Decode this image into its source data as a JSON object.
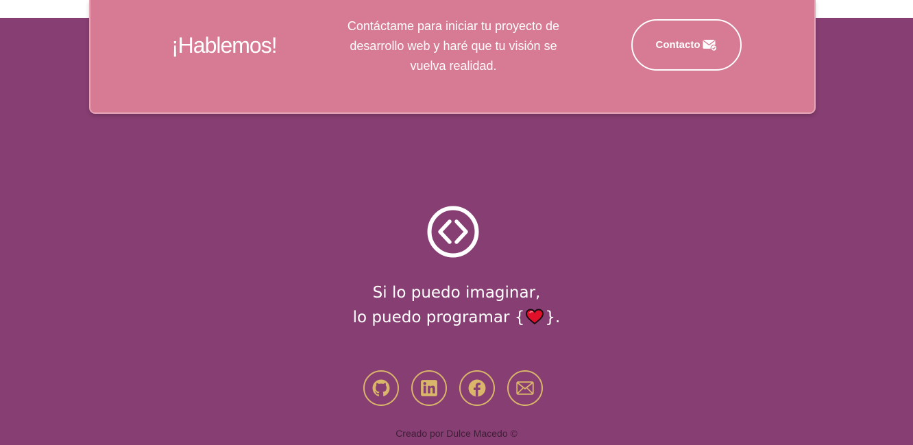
{
  "colors": {
    "background": "#873e72",
    "cta_card": "#d77a93",
    "accent_gold": "#d9b66a",
    "text_light": "#ffffff",
    "credit_text": "#3d1f37",
    "heart": "#e0102a"
  },
  "cta": {
    "title": "¡Hablemos!",
    "text": "Contáctame para iniciar tu proyecto de desarrollo web y haré que tu visión se vuelva realidad.",
    "button_label": "Contacto",
    "button_icon": "mail-check-icon"
  },
  "footer": {
    "logo_icon": "code-brackets-icon",
    "tagline_line1": "Si lo puedo imaginar,",
    "tagline_line2_start": "lo puedo programar {",
    "tagline_line2_end": "}.",
    "tagline_icon": "heart-icon",
    "social": [
      {
        "name": "github",
        "icon": "github-icon"
      },
      {
        "name": "linkedin",
        "icon": "linkedin-icon"
      },
      {
        "name": "facebook",
        "icon": "facebook-icon"
      },
      {
        "name": "email",
        "icon": "envelope-icon"
      }
    ],
    "credit": "Creado por Dulce Macedo ©"
  }
}
